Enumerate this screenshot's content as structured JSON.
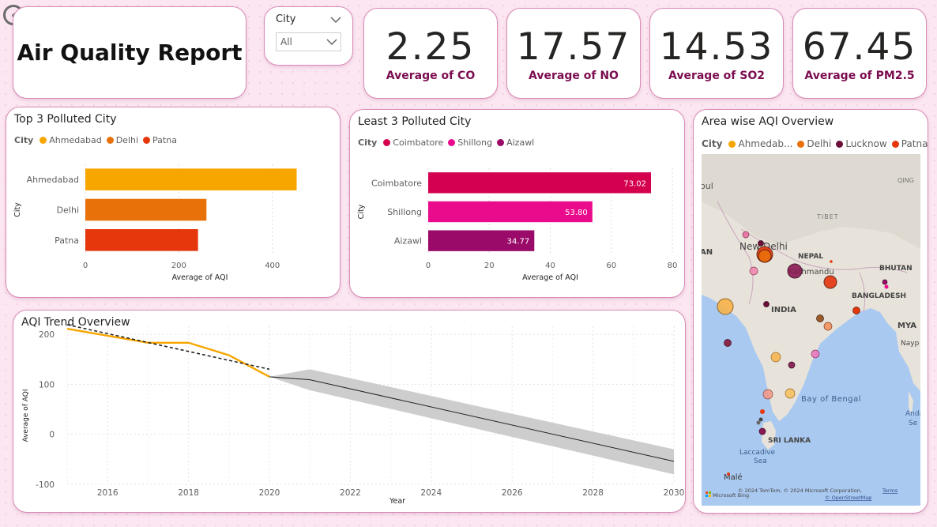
{
  "header": {
    "title": "Air Quality Report",
    "back_icon": "back-arrow-icon"
  },
  "slicer": {
    "label": "City",
    "value": "All"
  },
  "kpis": [
    {
      "value": "2.25",
      "label": "Average of CO"
    },
    {
      "value": "17.57",
      "label": "Average of NO"
    },
    {
      "value": "14.53",
      "label": "Average of SO2"
    },
    {
      "value": "67.45",
      "label": "Average of PM2.5"
    }
  ],
  "chart_data": [
    {
      "type": "bar",
      "title": "Top 3 Polluted City",
      "legend_title": "City",
      "categories": [
        "Ahmedabad",
        "Delhi",
        "Patna"
      ],
      "values": [
        452,
        259,
        241
      ],
      "colors": [
        "#f7a600",
        "#e8710a",
        "#e5360c"
      ],
      "xlabel": "Average of AQI",
      "ylabel": "City",
      "xticks": [
        "0",
        "200",
        "400"
      ],
      "xlim": [
        0,
        490
      ]
    },
    {
      "type": "bar",
      "title": "Least 3 Polluted City",
      "legend_title": "City",
      "categories": [
        "Coimbatore",
        "Shillong",
        "Aizawl"
      ],
      "values": [
        73.02,
        53.8,
        34.77
      ],
      "data_labels": [
        "73.02",
        "53.80",
        "34.77"
      ],
      "colors": [
        "#d4004f",
        "#ea0a8c",
        "#9a0a68"
      ],
      "xlabel": "Average of AQI",
      "ylabel": "City",
      "xticks": [
        "0",
        "20",
        "40",
        "60",
        "80"
      ],
      "xlim": [
        0,
        80
      ]
    },
    {
      "type": "line",
      "title": "AQI Trend Overview",
      "xlabel": "Year",
      "ylabel": "Average of AQI",
      "xlim": [
        2015,
        2030
      ],
      "ylim": [
        -100,
        200
      ],
      "xticks": [
        "2016",
        "2018",
        "2020",
        "2022",
        "2024",
        "2026",
        "2028",
        "2030"
      ],
      "yticks": [
        "-100",
        "0",
        "100",
        "200"
      ],
      "series": [
        {
          "x": [
            2015,
            2016,
            2017,
            2018,
            2019,
            2020
          ],
          "values": [
            211,
            197,
            183,
            183,
            158,
            115
          ]
        }
      ],
      "trendline": {
        "x": [
          2015,
          2020
        ],
        "values": [
          219,
          130
        ]
      },
      "forecast": {
        "x": [
          2020,
          2021,
          2030
        ],
        "values": [
          115,
          109,
          -54
        ],
        "upper": [
          115,
          130,
          -30
        ],
        "lower": [
          115,
          88,
          -80
        ]
      },
      "colors": {
        "actual": "#f7a600",
        "trend": "#252423",
        "forecast": "#252423",
        "band": "#c8c8c8"
      }
    }
  ],
  "map": {
    "title": "Area wise AQI Overview",
    "legend_title": "City",
    "legend": [
      {
        "name": "Ahmedab...",
        "color": "#f7a600"
      },
      {
        "name": "Delhi",
        "color": "#e8710a"
      },
      {
        "name": "Lucknow",
        "color": "#6b0f36"
      },
      {
        "name": "Patna",
        "color": "#e5360c"
      }
    ],
    "labels": {
      "tibet": "TIBET",
      "new_delhi": "New Delhi",
      "nepal": "NEPAL",
      "kathmandu": "Kathmandu",
      "bhutan": "BHUTAN",
      "bangladesh": "BANGLADESH",
      "india": "INDIA",
      "mya": "MYA",
      "nay": "Nayp",
      "bay_of_bengal": "Bay of Bengal",
      "sri_lanka": "SRI LANKA",
      "laccadive": "Laccadive",
      "sea": "Sea",
      "male": "Malé",
      "andaman": "Anda",
      "se": "Se",
      "pul": "oul",
      "an": "AN",
      "qing": "QING"
    },
    "attribution": "© 2024 TomTom, © 2024 Microsoft Corporation,",
    "terms": "Terms",
    "osm": "© OpenStreetMap",
    "bing": "Microsoft Bing"
  }
}
